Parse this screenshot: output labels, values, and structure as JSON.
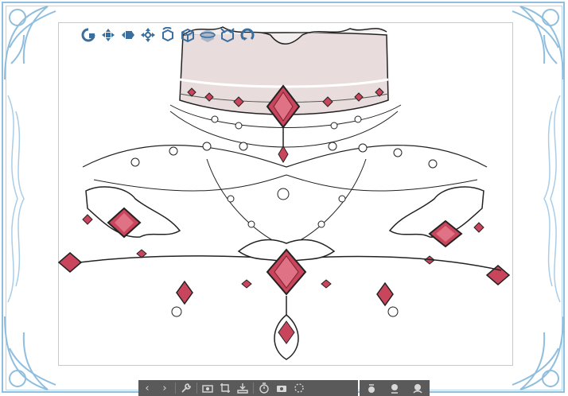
{
  "toolbar_3d": {
    "items": [
      {
        "name": "camera-rotate-icon"
      },
      {
        "name": "camera-pan-icon"
      },
      {
        "name": "camera-dolly-icon"
      },
      {
        "name": "object-move-icon"
      },
      {
        "name": "object-rotate-icon"
      },
      {
        "name": "object-rotate-xz-icon"
      },
      {
        "name": "object-rotate-xy-icon"
      },
      {
        "name": "object-scale-icon"
      },
      {
        "name": "reset-rotation-icon"
      }
    ],
    "accent": "#3a6e9e"
  },
  "bottom_bar": {
    "glyphs": {
      "prev": "‹",
      "next": "›"
    },
    "group1": [
      "prev-button",
      "next-button",
      "wrench-button",
      "camera-button",
      "crop-button",
      "layer-import-button",
      "timer-button",
      "screenshot-button",
      "select-area-button"
    ],
    "group2": [
      "pen-button",
      "brush-button",
      "paint-button"
    ]
  },
  "colors": {
    "frame": "#8fbedf",
    "gem": "#c9455c",
    "gem_dark": "#7a1f30",
    "band": "#e8dcdc",
    "toolbar_bg": "#5a5a5a"
  }
}
